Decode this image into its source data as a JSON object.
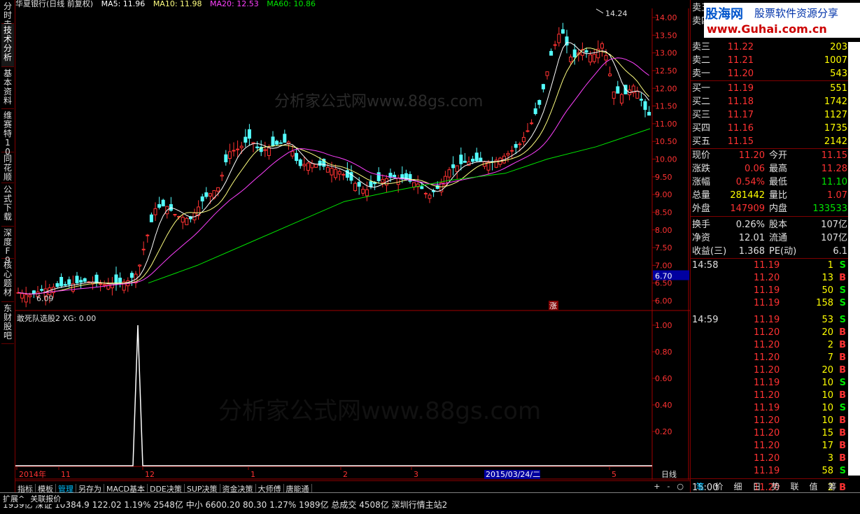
{
  "app": {
    "logo": "股海网",
    "slogan": "股票软件资源分享",
    "site": "www.Guhai.com.cn"
  },
  "left_tabs": [
    "分时走势",
    "技术分析",
    "基本资料",
    "维赛特10",
    "同花顺",
    "公式下载",
    "深度F9",
    "核心题材",
    "东财股吧"
  ],
  "legend": {
    "name": "华夏银行(日线 前复权)",
    "ma5": "MA5: 11.96",
    "ma10": "MA10: 11.98",
    "ma20": "MA20: 12.53",
    "ma60": "MA60: 10.86",
    "colors": {
      "name": "#e0e0e0",
      "ma5": "#ffffff",
      "ma10": "#ffff80",
      "ma20": "#ff40ff",
      "ma60": "#00e600"
    }
  },
  "price_axis": [
    "14.00",
    "13.50",
    "13.00",
    "12.50",
    "12.00",
    "11.50",
    "11.00",
    "10.50",
    "10.00",
    "9.50",
    "9.00",
    "8.50",
    "8.00",
    "7.50",
    "7.00",
    "6.50",
    "6.00"
  ],
  "price_tag": "6.70",
  "high_label": "14.24",
  "low_label": "6.09",
  "zhang_label": "涨",
  "watermark": "分析家公式网www.88gs.com",
  "watermark2": "分析家公式网www.88gs.com",
  "indicator": {
    "title": "敢死队选股2  XG: 0.00",
    "axis": [
      "1.00",
      "0.80",
      "0.60",
      "0.40",
      "0.20"
    ]
  },
  "date_axis": {
    "labels": [
      "2014年",
      "11",
      "12",
      "1",
      "2",
      "3",
      "5"
    ],
    "highlight": "2015/03/24/二",
    "period": "日线"
  },
  "nav_buttons": [
    "+",
    "-",
    "○"
  ],
  "bottom_tabs": [
    "指标",
    "模板",
    "管理",
    "另存为",
    "MACD基本",
    "DDE决策",
    "SUP决策",
    "资金决策",
    "大师傅",
    "唐能通"
  ],
  "bottom_selected": "管理",
  "expand_tabs": [
    "扩展^",
    "关联报价"
  ],
  "order_book": {
    "sell": [
      {
        "label": "卖五",
        "price": "",
        "qty": ""
      },
      {
        "label": "卖四",
        "price": "",
        "qty": ""
      },
      {
        "label": "卖三",
        "price": "11.22",
        "qty": "203"
      },
      {
        "label": "卖二",
        "price": "11.21",
        "qty": "1007"
      },
      {
        "label": "卖一",
        "price": "11.20",
        "qty": "543"
      }
    ],
    "buy": [
      {
        "label": "买一",
        "price": "11.19",
        "qty": "551"
      },
      {
        "label": "买二",
        "price": "11.18",
        "qty": "1742"
      },
      {
        "label": "买三",
        "price": "11.17",
        "qty": "1127"
      },
      {
        "label": "买四",
        "price": "11.16",
        "qty": "1735"
      },
      {
        "label": "买五",
        "price": "11.15",
        "qty": "2142"
      }
    ]
  },
  "quote": [
    {
      "l1": "现价",
      "v1": "11.20",
      "c1": "red",
      "l2": "今开",
      "v2": "11.15",
      "c2": "red"
    },
    {
      "l1": "涨跌",
      "v1": "0.06",
      "c1": "red",
      "l2": "最高",
      "v2": "11.28",
      "c2": "red"
    },
    {
      "l1": "涨幅",
      "v1": "0.54%",
      "c1": "red",
      "l2": "最低",
      "v2": "11.10",
      "c2": "grn"
    },
    {
      "l1": "总量",
      "v1": "281442",
      "c1": "yel",
      "l2": "量比",
      "v2": "1.07",
      "c2": "red"
    },
    {
      "l1": "外盘",
      "v1": "147909",
      "c1": "red",
      "l2": "内盘",
      "v2": "133533",
      "c2": "grn"
    },
    {
      "l1": "换手",
      "v1": "0.26%",
      "c1": "wht",
      "l2": "股本",
      "v2": "107亿",
      "c2": "wht"
    },
    {
      "l1": "净资",
      "v1": "12.01",
      "c1": "wht",
      "l2": "流通",
      "v2": "107亿",
      "c2": "wht"
    },
    {
      "l1": "收益(三)",
      "v1": "1.368",
      "c1": "wht",
      "l2": "PE(动)",
      "v2": "6.1",
      "c2": "wht"
    }
  ],
  "ticks": [
    {
      "t": "14:58",
      "p": "11.19",
      "q": "1",
      "s": "S"
    },
    {
      "t": "",
      "p": "11.20",
      "q": "13",
      "s": "B"
    },
    {
      "t": "",
      "p": "11.19",
      "q": "50",
      "s": "S"
    },
    {
      "t": "",
      "p": "11.19",
      "q": "158",
      "s": "S"
    },
    {
      "t": "14:59",
      "p": "11.19",
      "q": "53",
      "s": "S"
    },
    {
      "t": "",
      "p": "11.20",
      "q": "20",
      "s": "B"
    },
    {
      "t": "",
      "p": "11.20",
      "q": "2",
      "s": "B"
    },
    {
      "t": "",
      "p": "11.20",
      "q": "7",
      "s": "B"
    },
    {
      "t": "",
      "p": "11.20",
      "q": "20",
      "s": "B"
    },
    {
      "t": "",
      "p": "11.19",
      "q": "10",
      "s": "S"
    },
    {
      "t": "",
      "p": "11.20",
      "q": "10",
      "s": "B"
    },
    {
      "t": "",
      "p": "11.19",
      "q": "10",
      "s": "S"
    },
    {
      "t": "",
      "p": "11.20",
      "q": "10",
      "s": "B"
    },
    {
      "t": "",
      "p": "11.20",
      "q": "15",
      "s": "B"
    },
    {
      "t": "",
      "p": "11.20",
      "q": "17",
      "s": "B"
    },
    {
      "t": "",
      "p": "11.20",
      "q": "3",
      "s": "B"
    },
    {
      "t": "",
      "p": "11.19",
      "q": "58",
      "s": "S"
    },
    {
      "t": "15:00",
      "p": "11.20",
      "q": "2",
      "s": "B"
    }
  ],
  "right_tabs": [
    "笔",
    "价",
    "细",
    "日",
    "势",
    "联",
    "值",
    "筹"
  ],
  "status_bar": "1959亿   深证 10384.9  122.02  1.19%   2548亿   中小 6600.20  80.30  1.27%   1989亿   总成交 4508亿  深圳行情主站2"
}
